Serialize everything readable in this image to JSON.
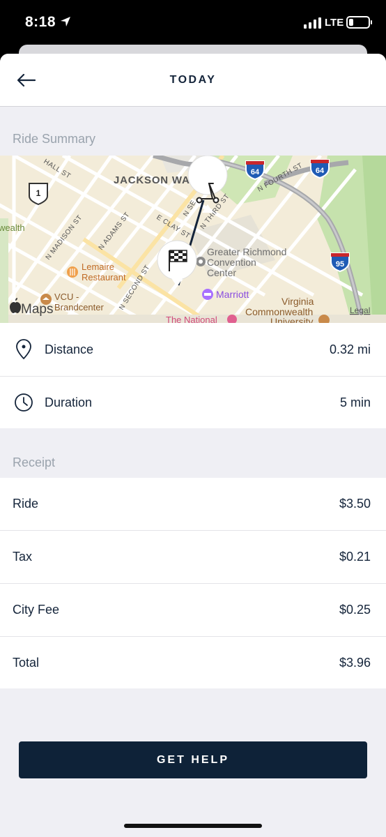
{
  "status_bar": {
    "time": "8:18",
    "network": "LTE"
  },
  "nav": {
    "title": "TODAY",
    "back_icon": "arrow-left-icon"
  },
  "ride_summary": {
    "label": "Ride Summary",
    "map": {
      "labels": {
        "jackson_ward": "JACKSON WARD",
        "hall_st": "HALL ST",
        "n_madison_st": "N MADISON ST",
        "n_adams_st": "N ADAMS ST",
        "e_clay_st": "E CLAY ST",
        "n_second_st": "N SECOND ST",
        "n_third_st": "N THIRD ST",
        "n_se": "N SE",
        "n_fourth_st": "N FOURTH ST",
        "wealth": "wealth",
        "lemaire_1": "Lemaire",
        "lemaire_2": "Restaurant",
        "vcu_1": "VCU -",
        "vcu_2": "Brandcenter",
        "convention_1": "Greater Richmond",
        "convention_2": "Convention",
        "convention_3": "Center",
        "marriott": "Marriott",
        "virginia_1": "Virginia",
        "virginia_2": "Commonwealth",
        "virginia_3": "University",
        "the_national": "The National",
        "maps": "Maps",
        "legal": "Legal",
        "shield_us1": "1",
        "shield_i64a": "64",
        "shield_i64b": "64",
        "shield_i95": "95"
      }
    },
    "rows": [
      {
        "icon": "location-pin-icon",
        "label": "Distance",
        "value": "0.32 mi"
      },
      {
        "icon": "clock-icon",
        "label": "Duration",
        "value": "5 min"
      }
    ]
  },
  "receipt": {
    "label": "Receipt",
    "items": [
      {
        "label": "Ride",
        "value": "$3.50"
      },
      {
        "label": "Tax",
        "value": "$0.21"
      },
      {
        "label": "City Fee",
        "value": "$0.25"
      },
      {
        "label": "Total",
        "value": "$3.96"
      }
    ]
  },
  "actions": {
    "get_help": "GET HELP"
  },
  "colors": {
    "primary": "#0e2238",
    "text": "#14243a",
    "muted": "#9aa3ad",
    "background": "#efeff4"
  }
}
